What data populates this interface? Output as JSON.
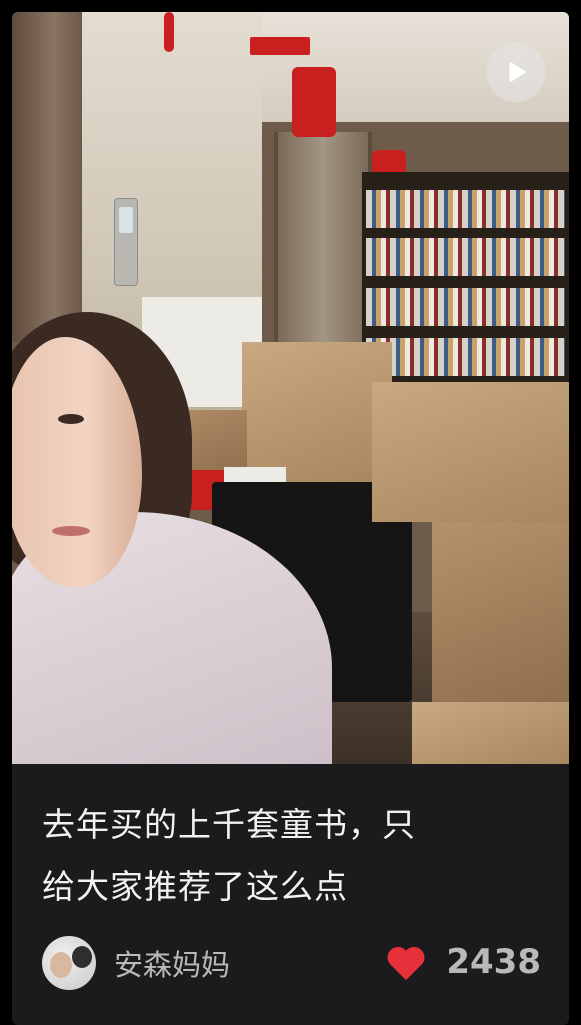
{
  "media": {
    "type": "video",
    "play_icon": "play-icon"
  },
  "post": {
    "caption_line1": "去年买的上千套童书，只",
    "caption_line2": "给大家推荐了这么点"
  },
  "author": {
    "name": "安森妈妈",
    "avatar_icon": "avatar"
  },
  "stats": {
    "likes": "2438",
    "like_icon": "heart-icon",
    "like_color": "#e8303a"
  }
}
